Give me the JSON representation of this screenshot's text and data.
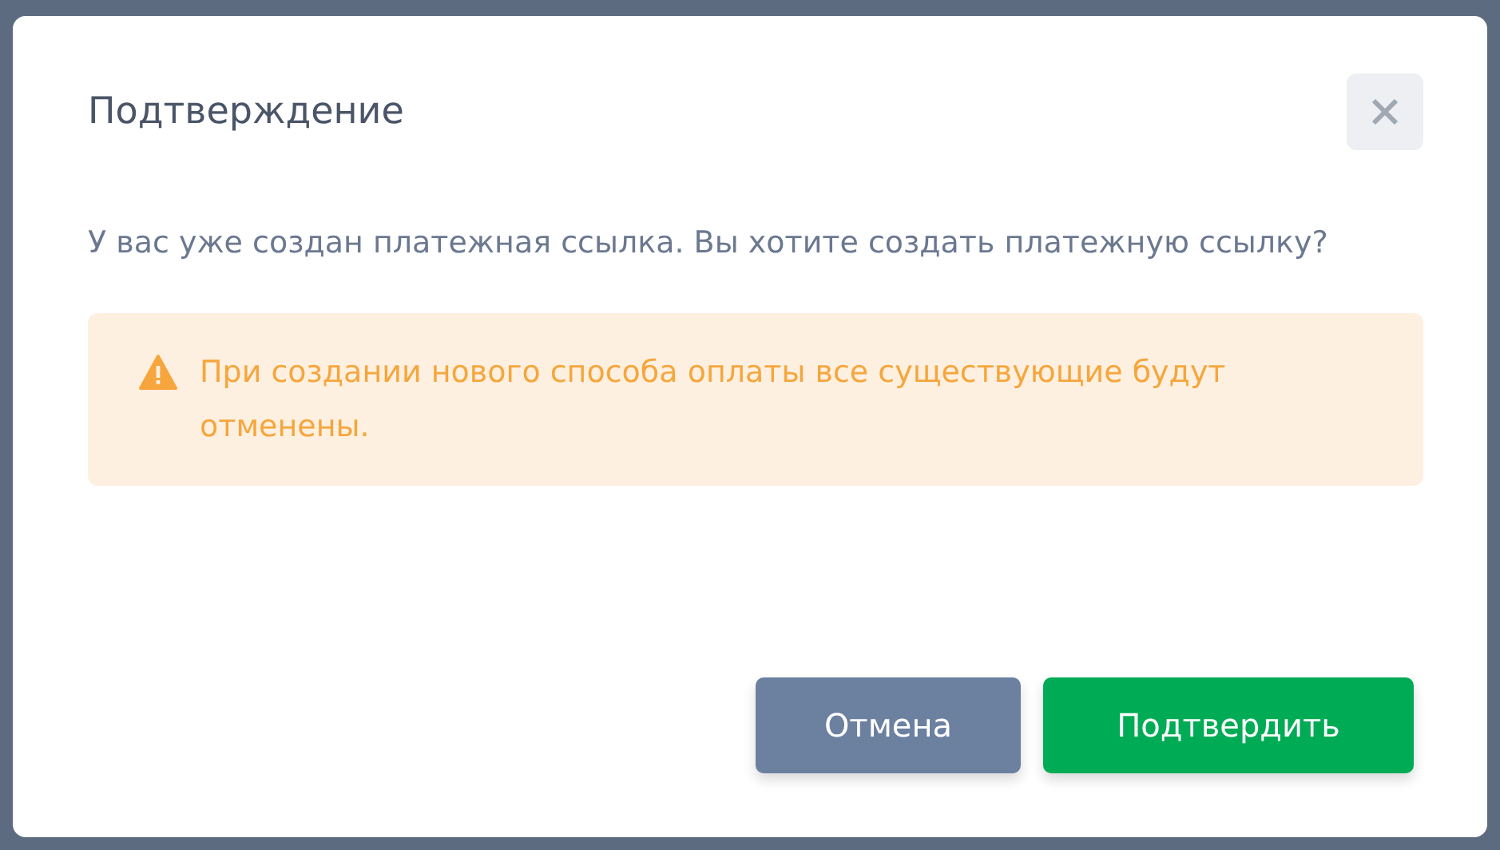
{
  "dialog": {
    "title": "Подтверждение",
    "message": "У вас уже создан платежная ссылка. Вы хотите создать платежную ссылку?",
    "warning": "При создании нового способа оплаты все существующие будут отменены.",
    "buttons": [
      {
        "label": "Отмена",
        "kind": "secondary"
      },
      {
        "label": "Подтвердить",
        "kind": "primary"
      }
    ]
  }
}
